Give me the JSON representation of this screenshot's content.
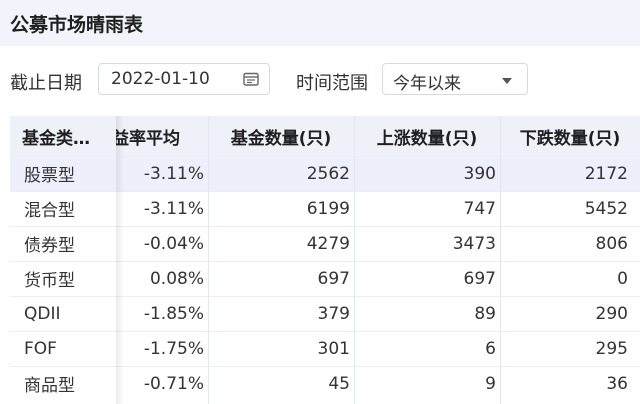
{
  "header": {
    "title": "公募市场晴雨表"
  },
  "filters": {
    "date_label": "截止日期",
    "date_value": "2022-01-10",
    "range_label": "时间范围",
    "range_value": "今年以来"
  },
  "table": {
    "columns": [
      "基金类…",
      "益率平均",
      "基金数量(只)",
      "上涨数量(只)",
      "下跌数量(只)"
    ],
    "rows": [
      [
        "股票型",
        "-3.11%",
        "2562",
        "390",
        "2172"
      ],
      [
        "混合型",
        "-3.11%",
        "6199",
        "747",
        "5452"
      ],
      [
        "债券型",
        "-0.04%",
        "4279",
        "3473",
        "806"
      ],
      [
        "货币型",
        "0.08%",
        "697",
        "697",
        "0"
      ],
      [
        "QDII",
        "-1.85%",
        "379",
        "89",
        "290"
      ],
      [
        "FOF",
        "-1.75%",
        "301",
        "6",
        "295"
      ],
      [
        "商品型",
        "-0.71%",
        "45",
        "9",
        "36"
      ]
    ]
  },
  "colors": {
    "header_bg": "#f2f4fb",
    "table_head_bg": "#eef1f8",
    "row_hover_bg": "#edf0fa"
  },
  "icons": {
    "date": "calendar-icon",
    "select": "chevron-down-icon"
  }
}
